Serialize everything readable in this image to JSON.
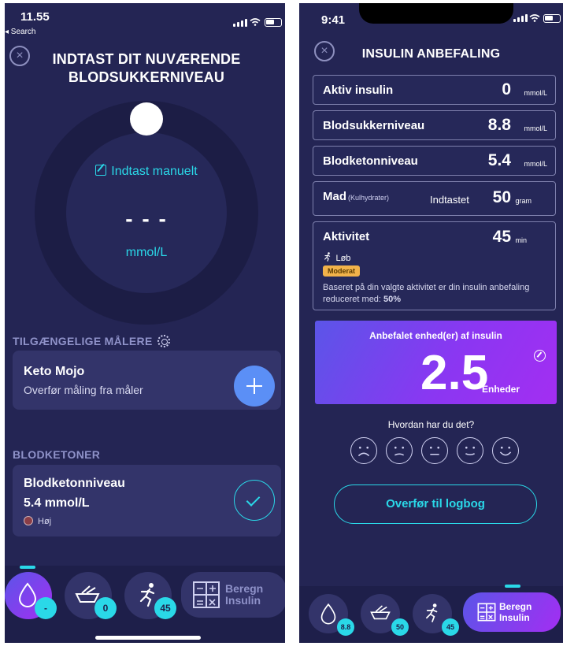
{
  "left": {
    "status": {
      "time": "11.55",
      "back_label": "◂ Search"
    },
    "title": "INDTAST DIT NUVÆRENDE BLODSUKKERNIVEAU",
    "manual_label": "Indtast manuelt",
    "reading_value": "- - -",
    "reading_unit": "mmol/L",
    "meters_heading": "TILGÆNGELIGE MÅLERE",
    "meter": {
      "name": "Keto Mojo",
      "subtitle": "Overfør måling fra måler"
    },
    "ketones_heading": "BLODKETONER",
    "ketone_card": {
      "title": "Blodketonniveau",
      "value": "5.4 mmol/L",
      "status": "Høj"
    },
    "tabbar": {
      "drop_badge": "-",
      "food_badge": "0",
      "activity_badge": "45",
      "calc_label_1": "Beregn",
      "calc_label_2": "Insulin"
    }
  },
  "right": {
    "status": {
      "time": "9:41"
    },
    "title": "INSULIN ANBEFALING",
    "rows": [
      {
        "label": "Aktiv insulin",
        "value": "0",
        "unit": "mmol/L"
      },
      {
        "label": "Blodsukkerniveau",
        "value": "8.8",
        "unit": "mmol/L"
      },
      {
        "label": "Blodketonniveau",
        "value": "5.4",
        "unit": "mmol/L"
      }
    ],
    "food": {
      "label": "Mad",
      "note": "(Kulhydrater)",
      "mid": "Indtastet",
      "value": "50",
      "unit": "gram"
    },
    "activity": {
      "label": "Aktivitet",
      "value": "45",
      "unit": "min",
      "type": "Løb",
      "intensity": "Moderat",
      "note": "Baseret på din valgte aktivitet er din insulin anbefaling reduceret med:",
      "reduction": "50%"
    },
    "recommendation": {
      "title": "Anbefalet enhed(er) af insulin",
      "value": "2.5",
      "unit": "Enheder"
    },
    "feedback_question": "Hvordan har du det?",
    "transfer_label": "Overfør til logbog",
    "tabbar": {
      "drop_badge": "8.8",
      "food_badge": "50",
      "activity_badge": "45",
      "calc_label_1": "Beregn",
      "calc_label_2": "Insulin"
    }
  },
  "colors": {
    "background": "#242554",
    "card": "#33346a",
    "accent": "#2ad8e8",
    "plus_button": "#5b8ff6",
    "recommendation_start": "#5b55e8",
    "recommendation_end": "#a32ef2",
    "moderate_tag": "#f2b24a"
  },
  "icons": [
    "close-icon",
    "pencil-icon",
    "gear-icon",
    "plus-icon",
    "check-icon",
    "drop-icon",
    "bowl-icon",
    "runner-icon",
    "calculator-icon",
    "edit-icon",
    "sad-face-icon",
    "neutral-face-icon",
    "happy-face-icon"
  ]
}
